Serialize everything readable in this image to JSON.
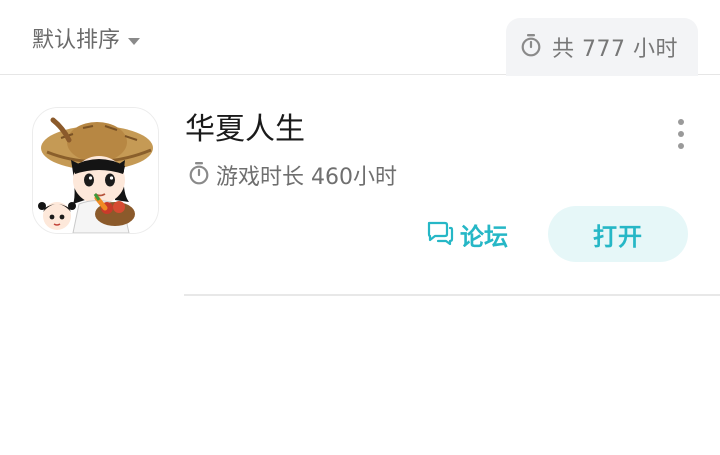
{
  "header": {
    "sort_label": "默认排序",
    "sort_icon": "caret-down-icon",
    "total_icon": "timer-icon",
    "total_label": "共 777 小时"
  },
  "games": [
    {
      "title": "华夏人生",
      "icon": "game-cover-image",
      "playtime_icon": "timer-icon",
      "playtime_label": "游戏时长 460小时",
      "forum_icon": "chat-bubble-icon",
      "forum_label": "论坛",
      "open_label": "打开",
      "more_icon": "more-vertical-icon"
    }
  ],
  "colors": {
    "accent": "#26b7c6",
    "accent_bg": "#e6f7f8",
    "pill_bg": "#f3f4f6",
    "divider": "#e8e8e8"
  }
}
